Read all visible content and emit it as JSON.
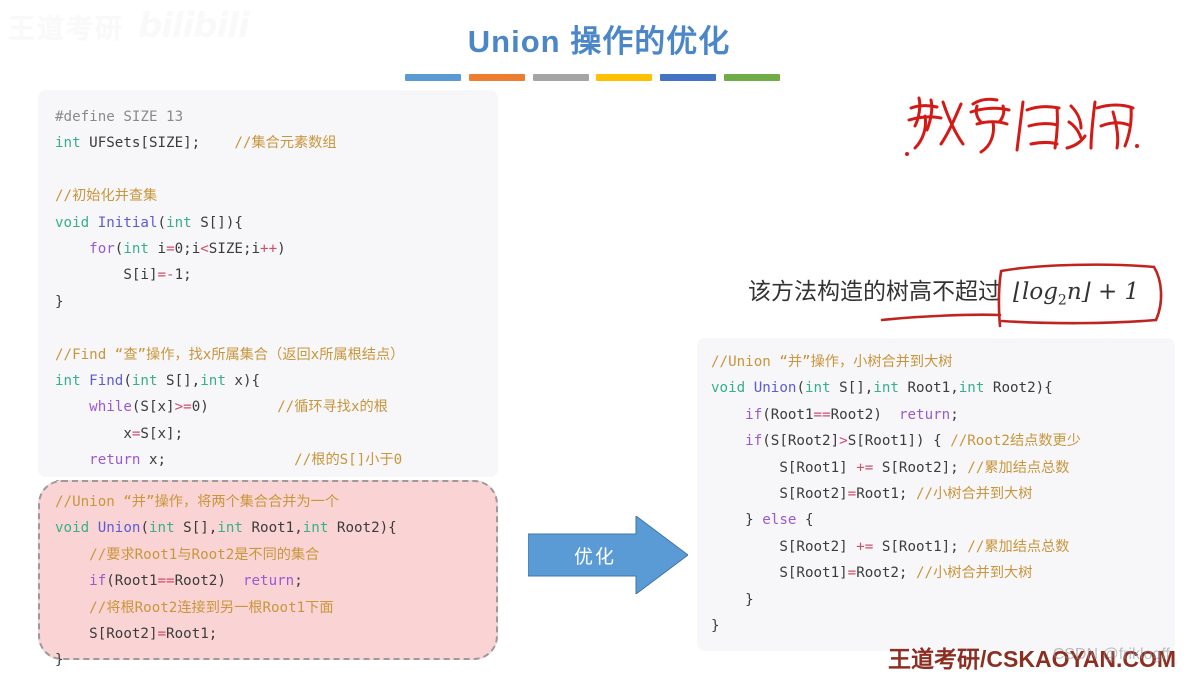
{
  "watermark": {
    "top_left_cn": "王道考研",
    "top_left_brand": "bilibili",
    "bottom_brand": "王道考研/CSKAOYAN.COM",
    "bottom_csdn": "CSDN @friklogff"
  },
  "title": {
    "text": "Union 操作的优化",
    "color": "#4a86c8",
    "bars": [
      "#5b9bd5",
      "#ed7d31",
      "#a5a5a5",
      "#ffc000",
      "#4472c4",
      "#70ad47"
    ]
  },
  "code_left": {
    "lines": [
      [
        {
          "t": "pre",
          "s": "#define SIZE 13"
        }
      ],
      [
        {
          "t": "type",
          "s": "int"
        },
        {
          "t": "pln",
          "s": " UFSets[SIZE];    "
        },
        {
          "t": "cmt",
          "s": "//集合元素数组"
        }
      ],
      [
        {
          "t": "pln",
          "s": ""
        }
      ],
      [
        {
          "t": "cmt",
          "s": "//初始化并查集"
        }
      ],
      [
        {
          "t": "type",
          "s": "void"
        },
        {
          "t": "pln",
          "s": " "
        },
        {
          "t": "fn",
          "s": "Initial"
        },
        {
          "t": "pln",
          "s": "("
        },
        {
          "t": "type",
          "s": "int"
        },
        {
          "t": "pln",
          "s": " S[]){"
        }
      ],
      [
        {
          "t": "pln",
          "s": "    "
        },
        {
          "t": "kw",
          "s": "for"
        },
        {
          "t": "pln",
          "s": "("
        },
        {
          "t": "type",
          "s": "int"
        },
        {
          "t": "pln",
          "s": " i"
        },
        {
          "t": "op",
          "s": "="
        },
        {
          "t": "pln",
          "s": "0;i"
        },
        {
          "t": "op",
          "s": "<"
        },
        {
          "t": "pln",
          "s": "SIZE;i"
        },
        {
          "t": "op",
          "s": "++"
        },
        {
          "t": "pln",
          "s": ")"
        }
      ],
      [
        {
          "t": "pln",
          "s": "        S[i]"
        },
        {
          "t": "op",
          "s": "=-"
        },
        {
          "t": "pln",
          "s": "1;"
        }
      ],
      [
        {
          "t": "pln",
          "s": "}"
        }
      ],
      [
        {
          "t": "pln",
          "s": ""
        }
      ],
      [
        {
          "t": "cmt",
          "s": "//Find “查”操作，找x所属集合（返回x所属根结点）"
        }
      ],
      [
        {
          "t": "type",
          "s": "int"
        },
        {
          "t": "pln",
          "s": " "
        },
        {
          "t": "fn",
          "s": "Find"
        },
        {
          "t": "pln",
          "s": "("
        },
        {
          "t": "type",
          "s": "int"
        },
        {
          "t": "pln",
          "s": " S[],"
        },
        {
          "t": "type",
          "s": "int"
        },
        {
          "t": "pln",
          "s": " x){"
        }
      ],
      [
        {
          "t": "pln",
          "s": "    "
        },
        {
          "t": "kw",
          "s": "while"
        },
        {
          "t": "pln",
          "s": "(S[x]"
        },
        {
          "t": "op",
          "s": ">="
        },
        {
          "t": "pln",
          "s": "0)        "
        },
        {
          "t": "cmt",
          "s": "//循环寻找x的根"
        }
      ],
      [
        {
          "t": "pln",
          "s": "        x"
        },
        {
          "t": "op",
          "s": "="
        },
        {
          "t": "pln",
          "s": "S[x];"
        }
      ],
      [
        {
          "t": "pln",
          "s": "    "
        },
        {
          "t": "kw",
          "s": "return"
        },
        {
          "t": "pln",
          "s": " x;               "
        },
        {
          "t": "cmt",
          "s": "//根的S[]小于0"
        }
      ],
      [
        {
          "t": "pln",
          "s": "}"
        }
      ]
    ]
  },
  "code_pink": {
    "lines": [
      [
        {
          "t": "cmt",
          "s": "//Union “并”操作，将两个集合合并为一个"
        }
      ],
      [
        {
          "t": "type",
          "s": "void"
        },
        {
          "t": "pln",
          "s": " "
        },
        {
          "t": "fn",
          "s": "Union"
        },
        {
          "t": "pln",
          "s": "("
        },
        {
          "t": "type",
          "s": "int"
        },
        {
          "t": "pln",
          "s": " S[],"
        },
        {
          "t": "type",
          "s": "int"
        },
        {
          "t": "pln",
          "s": " Root1,"
        },
        {
          "t": "type",
          "s": "int"
        },
        {
          "t": "pln",
          "s": " Root2){"
        }
      ],
      [
        {
          "t": "pln",
          "s": "    "
        },
        {
          "t": "cmt",
          "s": "//要求Root1与Root2是不同的集合"
        }
      ],
      [
        {
          "t": "pln",
          "s": "    "
        },
        {
          "t": "kw",
          "s": "if"
        },
        {
          "t": "pln",
          "s": "(Root1"
        },
        {
          "t": "op",
          "s": "=="
        },
        {
          "t": "pln",
          "s": "Root2)  "
        },
        {
          "t": "kw",
          "s": "return"
        },
        {
          "t": "pln",
          "s": ";"
        }
      ],
      [
        {
          "t": "pln",
          "s": "    "
        },
        {
          "t": "cmt",
          "s": "//将根Root2连接到另一根Root1下面"
        }
      ],
      [
        {
          "t": "pln",
          "s": "    S[Root2]"
        },
        {
          "t": "op",
          "s": "="
        },
        {
          "t": "pln",
          "s": "Root1;"
        }
      ],
      [
        {
          "t": "pln",
          "s": "}"
        }
      ]
    ]
  },
  "code_right": {
    "lines": [
      [
        {
          "t": "cmt",
          "s": "//Union “并”操作，小树合并到大树"
        }
      ],
      [
        {
          "t": "type",
          "s": "void"
        },
        {
          "t": "pln",
          "s": " "
        },
        {
          "t": "fn",
          "s": "Union"
        },
        {
          "t": "pln",
          "s": "("
        },
        {
          "t": "type",
          "s": "int"
        },
        {
          "t": "pln",
          "s": " S[],"
        },
        {
          "t": "type",
          "s": "int"
        },
        {
          "t": "pln",
          "s": " Root1,"
        },
        {
          "t": "type",
          "s": "int"
        },
        {
          "t": "pln",
          "s": " Root2){"
        }
      ],
      [
        {
          "t": "pln",
          "s": "    "
        },
        {
          "t": "kw",
          "s": "if"
        },
        {
          "t": "pln",
          "s": "(Root1"
        },
        {
          "t": "op",
          "s": "=="
        },
        {
          "t": "pln",
          "s": "Root2)  "
        },
        {
          "t": "kw",
          "s": "return"
        },
        {
          "t": "pln",
          "s": ";"
        }
      ],
      [
        {
          "t": "pln",
          "s": "    "
        },
        {
          "t": "kw",
          "s": "if"
        },
        {
          "t": "pln",
          "s": "(S[Root2]"
        },
        {
          "t": "op",
          "s": ">"
        },
        {
          "t": "pln",
          "s": "S[Root1]) { "
        },
        {
          "t": "cmt",
          "s": "//Root2结点数更少"
        }
      ],
      [
        {
          "t": "pln",
          "s": "        S[Root1] "
        },
        {
          "t": "op",
          "s": "+="
        },
        {
          "t": "pln",
          "s": " S[Root2]; "
        },
        {
          "t": "cmt",
          "s": "//累加结点总数"
        }
      ],
      [
        {
          "t": "pln",
          "s": "        S[Root2]"
        },
        {
          "t": "op",
          "s": "="
        },
        {
          "t": "pln",
          "s": "Root1; "
        },
        {
          "t": "cmt",
          "s": "//小树合并到大树"
        }
      ],
      [
        {
          "t": "pln",
          "s": "    } "
        },
        {
          "t": "kw",
          "s": "else"
        },
        {
          "t": "pln",
          "s": " {"
        }
      ],
      [
        {
          "t": "pln",
          "s": "        S[Root2] "
        },
        {
          "t": "op",
          "s": "+="
        },
        {
          "t": "pln",
          "s": " S[Root1]; "
        },
        {
          "t": "cmt",
          "s": "//累加结点总数"
        }
      ],
      [
        {
          "t": "pln",
          "s": "        S[Root1]"
        },
        {
          "t": "op",
          "s": "="
        },
        {
          "t": "pln",
          "s": "Root2; "
        },
        {
          "t": "cmt",
          "s": "//小树合并到大树"
        }
      ],
      [
        {
          "t": "pln",
          "s": "    }"
        }
      ],
      [
        {
          "t": "pln",
          "s": "}"
        }
      ]
    ]
  },
  "arrow": {
    "label": "优化",
    "color": "#5b9bd5"
  },
  "handwriting": {
    "note_text": "数学归纳",
    "ink_color": "#d41a16"
  },
  "formula": {
    "prefix": "该方法构造的树高不超过",
    "expression": "⌊log₂n⌋ + 1",
    "expr_base": "log",
    "expr_sub": "2",
    "expr_var": "n",
    "expr_tail": "+ 1",
    "annotation_color": "#c0241f"
  }
}
